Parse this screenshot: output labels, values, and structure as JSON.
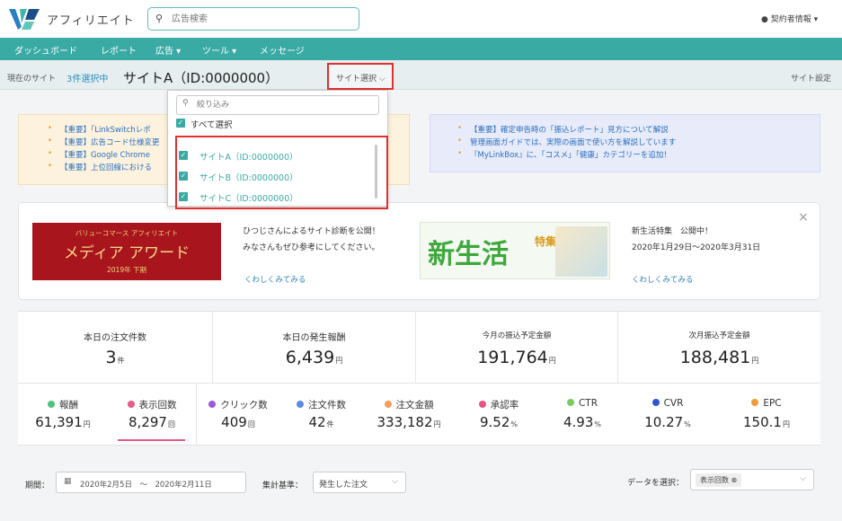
{
  "header": {
    "brand": "アフィリエイト",
    "search_placeholder": "広告検索",
    "account": "契約者情報 ▾"
  },
  "nav": [
    "ダッシュボード",
    "レポート",
    "広告 ▾",
    "ツール ▾",
    "メッセージ"
  ],
  "site_bar": {
    "current_label": "現在のサイト",
    "selected_count": "3件選択中",
    "site_name": "サイトA（ID:0000000）",
    "site_select": "サイト選択 ⌵",
    "site_settings": "サイト設定"
  },
  "dropdown": {
    "filter_placeholder": "絞り込み",
    "select_all": "すべて選択",
    "sites": [
      "サイトA（ID:0000000）",
      "サイトB（ID:0000000）",
      "サイトC（ID:0000000）"
    ]
  },
  "notices_left": [
    "【重要】「LinkSwitchレポ",
    "【重要】広告コード仕様変更",
    "【重要】Google Chrome ",
    "【重要】上位回線における"
  ],
  "notices_right": [
    "【重要】確定申告時の「振込レポート」見方について解説",
    "管理画面ガイドでは、実際の画面で使い方を解説しています",
    "『MyLinkBox』に、「コスメ」「健康」カテゴリーを追加！"
  ],
  "banner": {
    "award_top": "バリューコマース アフィリエイト",
    "award_title": "メディア アワード",
    "award_year": "2019年 下期",
    "desc1_line1": "ひつじさんによるサイト診断を公開！",
    "desc1_line2": "みなさんもぜひ参考にしてください。",
    "link1": "くわしくみてみる",
    "newlife": "新生活",
    "newlife_toku": "特集",
    "desc2_line1": "新生活特集　公開中！",
    "desc2_line2": "2020年1月29日～2020年3月31日",
    "link2": "くわしくみてみる",
    "close": "×"
  },
  "stats_top": [
    {
      "label": "本日の注文件数",
      "value": "3",
      "unit": "件"
    },
    {
      "label": "本日の発生報酬",
      "value": "6,439",
      "unit": "円"
    },
    {
      "label": "今月の振込予定金額",
      "value": "191,764",
      "unit": "円"
    },
    {
      "label": "次月振込予定金額",
      "value": "188,481",
      "unit": "円"
    }
  ],
  "stats_bottom": [
    {
      "label": "報酬",
      "value": "61,391",
      "unit": "円",
      "color": "#4cc47d"
    },
    {
      "label": "表示回数",
      "value": "8,297",
      "unit": "回",
      "color": "#e65a8c"
    },
    {
      "label": "クリック数",
      "value": "409",
      "unit": "回",
      "color": "#9b59d6"
    },
    {
      "label": "注文件数",
      "value": "42",
      "unit": "件",
      "color": "#5a8ddc"
    },
    {
      "label": "注文金額",
      "value": "333,182",
      "unit": "円",
      "color": "#f3a05a"
    },
    {
      "label": "承認率",
      "value": "9.52",
      "unit": "%",
      "color": "#e6547f"
    },
    {
      "label": "CTR",
      "value": "4.93",
      "unit": "%",
      "color": "#78cc5c"
    },
    {
      "label": "CVR",
      "value": "10.27",
      "unit": "%",
      "color": "#2e54d4"
    },
    {
      "label": "EPC",
      "value": "150.1",
      "unit": "円",
      "color": "#f29a3a"
    }
  ],
  "controls": {
    "period_label": "期間：",
    "period": "2020年2月5日　〜　2020年2月11日",
    "basis_label": "集計基準：",
    "basis": "発生した注文",
    "data_label": "データを選択：",
    "data_tag": "表示回数 ⊗"
  }
}
